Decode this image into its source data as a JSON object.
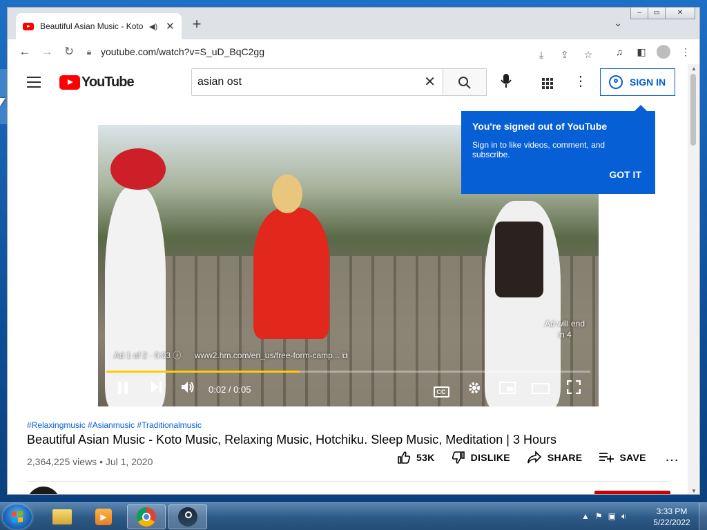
{
  "browser": {
    "tab_title": "Beautiful Asian Music - Koto",
    "tab_icon": "youtube-favicon",
    "url": "youtube.com/watch?v=S_uD_BqC2gg",
    "new_tab_symbol": "+",
    "close_symbol": "✕",
    "tab_search_symbol": "⌄",
    "window_controls": {
      "minimize": "‒",
      "maximize": "▭",
      "close": "✕"
    }
  },
  "youtube": {
    "logo_text": "YouTube",
    "search_value": "asian ost",
    "signin_label": "SIGN IN",
    "tooltip": {
      "title": "You're signed out of YouTube",
      "body": "Sign in to like videos, comment, and subscribe.",
      "button": "GOT IT"
    }
  },
  "player": {
    "ad_end_line1": "Ad will end",
    "ad_end_line2": "in 4",
    "ad_label": "Ad 1 of 2 · 0:03",
    "ad_info_symbol": "ⓘ",
    "ad_url": "www2.hm.com/en_us/free-form-camp...",
    "ad_url_symbol": "⧉",
    "time": "0:02 / 0:05",
    "cc_label": "CC",
    "progress_fraction": 0.4,
    "accent_color": "#ffcc00"
  },
  "video": {
    "hashtags": "#Relaxingmusic #Asianmusic #Traditionalmusic",
    "title": "Beautiful Asian Music - Koto Music, Relaxing Music, Hotchiku. Sleep Music, Meditation | 3 Hours",
    "views": "2,364,225 views • Jul 1, 2020",
    "like_count": "53K",
    "dislike_label": "DISLIKE",
    "share_label": "SHARE",
    "save_label": "SAVE",
    "more_symbol": "..."
  },
  "taskbar": {
    "clock_time": "3:33 PM",
    "clock_date": "5/22/2022",
    "tray_arrow": "▲"
  },
  "colors": {
    "youtube_red": "#ff0000",
    "link_blue": "#065fd4",
    "taskbar": "#2f5b88"
  }
}
